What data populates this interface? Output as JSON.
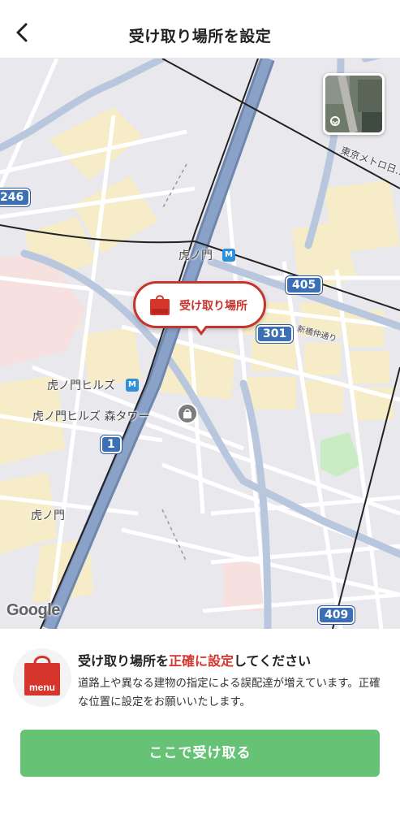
{
  "header": {
    "title": "受け取り場所を設定",
    "back_icon": "chevron-left-icon"
  },
  "map": {
    "pin_label": "受け取り場所",
    "pin_logo_text": "menu",
    "labels": {
      "toranomon": "虎ノ門",
      "toranomon_hills": "虎ノ門ヒルズ",
      "toranomon_hills_mori_tower": "虎ノ門ヒルズ 森タワー",
      "toranomon_area": "虎ノ門",
      "shinbashi_naka": "新橋仲通り",
      "tokyo_metro": "東京メトロ日…",
      "google": "Google"
    },
    "route_shields": {
      "r405": "405",
      "r301": "301",
      "r246": "246",
      "r1": "1",
      "r409": "409"
    },
    "metro_icon_text": "M",
    "colors": {
      "road_major": "#7f97bd",
      "block_yellow": "#f6ecc7",
      "pin_red": "#c6342d",
      "route_blue": "#3b6fb6"
    }
  },
  "panel": {
    "logo_text": "menu",
    "title_before": "受け取り場所を",
    "title_emphasis": "正確に設定",
    "title_after": "してください",
    "description": "道路上や異なる建物の指定による誤配達が増えています。正確な位置に設定をお願いいたします。",
    "confirm_button": "ここで受け取る",
    "accent_color": "#66c275"
  }
}
